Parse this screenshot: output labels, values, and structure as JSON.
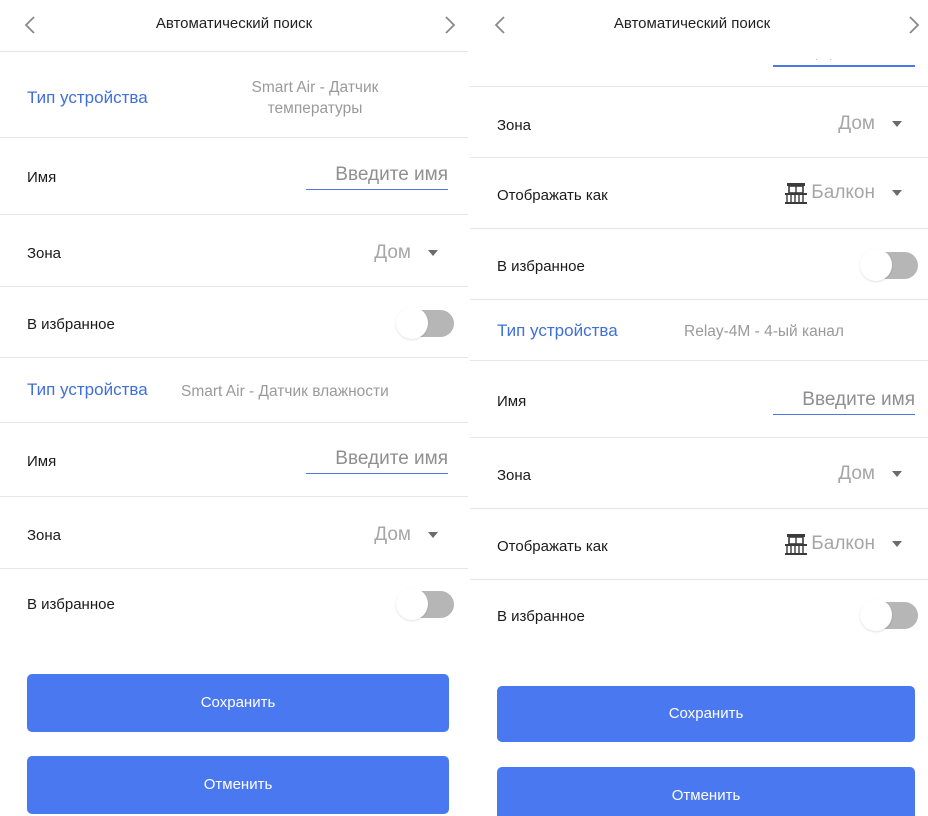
{
  "left": {
    "title": "Автоматический поиск",
    "devices": [
      {
        "device_type_label": "Тип устройства",
        "device_type_value": "Smart Air - Датчик температуры",
        "device_type_value_line1": "Smart Air - Датчик",
        "device_type_value_line2": "температуры",
        "name_label": "Имя",
        "name_placeholder": "Введите имя",
        "zone_label": "Зона",
        "zone_value": "Дом",
        "favorite_label": "В избранное",
        "favorite_on": false
      },
      {
        "device_type_label": "Тип устройства",
        "device_type_value": "Smart Air - Датчик влажности",
        "name_label": "Имя",
        "name_placeholder": "Введите имя",
        "zone_label": "Зона",
        "zone_value": "Дом",
        "favorite_label": "В избранное",
        "favorite_on": false
      }
    ],
    "save_label": "Сохранить",
    "cancel_label": "Отменить"
  },
  "right": {
    "title": "Автоматический поиск",
    "top_partial_placeholder": "· ·",
    "device_a": {
      "zone_label": "Зона",
      "zone_value": "Дом",
      "display_label": "Отображать как",
      "display_value": "Балкон",
      "display_icon": "balcony-icon",
      "favorite_label": "В избранное",
      "favorite_on": false
    },
    "device_b": {
      "device_type_label": "Тип устройства",
      "device_type_value": "Relay-4M - 4-ый канал",
      "name_label": "Имя",
      "name_placeholder": "Введите имя",
      "zone_label": "Зона",
      "zone_value": "Дом",
      "display_label": "Отображать как",
      "display_value": "Балкон",
      "display_icon": "balcony-icon",
      "favorite_label": "В избранное",
      "favorite_on": false
    },
    "save_label": "Сохранить",
    "cancel_label": "Отменить"
  },
  "colors": {
    "accent": "#4a78f0",
    "label_blue": "#3f6fd8",
    "toggle_off_track": "#b6b6b6",
    "divider": "#e6e6e6"
  }
}
